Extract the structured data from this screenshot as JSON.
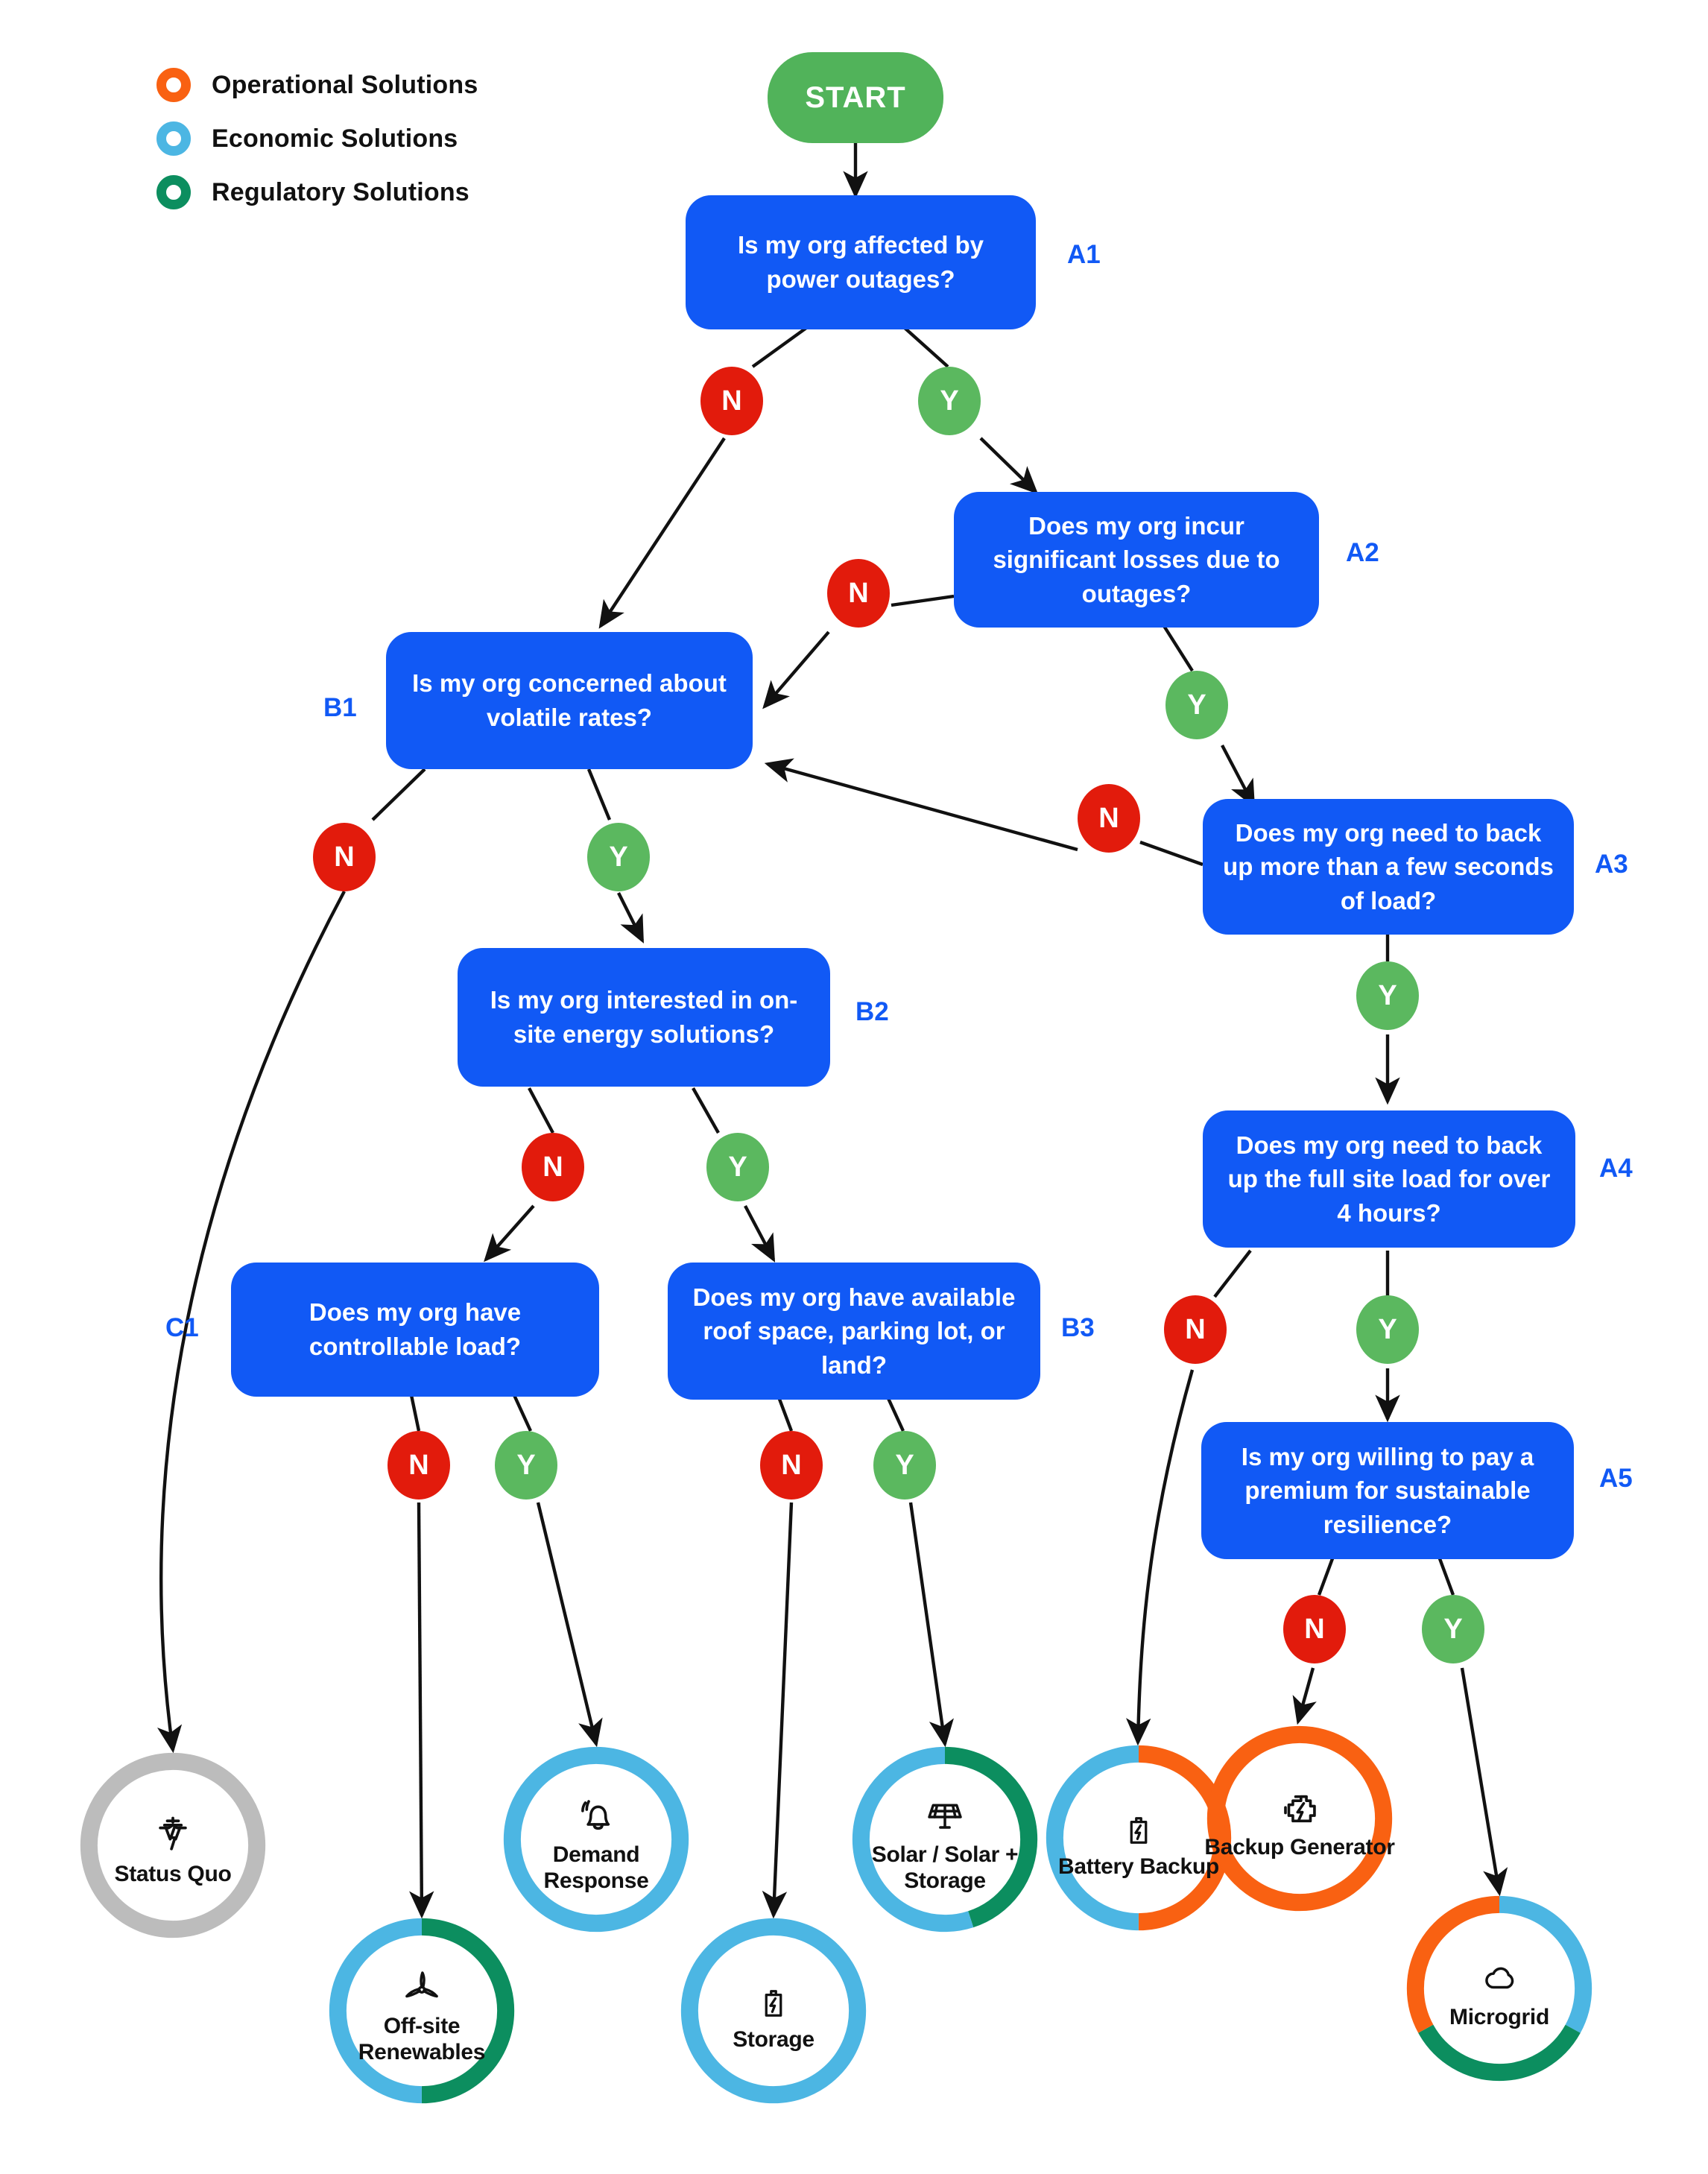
{
  "legend": {
    "items": [
      {
        "label": "Operational Solutions",
        "color": "#f96112",
        "icon": "ring-icon"
      },
      {
        "label": "Economic Solutions",
        "color": "#4cb6e3",
        "icon": "ring-icon"
      },
      {
        "label": "Regulatory Solutions",
        "color": "#0c8e5f",
        "icon": "ring-icon"
      }
    ]
  },
  "palette": {
    "question_blue": "#1159f5",
    "start_green": "#51b35a",
    "no_red": "#e21b0c",
    "yes_green": "#5bb85f",
    "operational_orange": "#f96112",
    "economic_blue": "#4cb6e3",
    "regulatory_green": "#0c8e5f",
    "status_quo_gray": "#bcbcbc"
  },
  "start": {
    "label": "START"
  },
  "questions": [
    {
      "id": "A1",
      "tag": "A1",
      "text": "Is my org affected by power outages?"
    },
    {
      "id": "A2",
      "tag": "A2",
      "text": "Does my org incur significant losses due to outages?"
    },
    {
      "id": "B1",
      "tag": "B1",
      "text": "Is my org concerned about volatile rates?"
    },
    {
      "id": "A3",
      "tag": "A3",
      "text": "Does my org need to back up more than a few seconds of load?"
    },
    {
      "id": "B2",
      "tag": "B2",
      "text": "Is my org interested in on-site energy solutions?"
    },
    {
      "id": "A4",
      "tag": "A4",
      "text": "Does my org need to back up the full site load for over 4 hours?"
    },
    {
      "id": "C1",
      "tag": "C1",
      "text": "Does my org have controllable load?"
    },
    {
      "id": "B3",
      "tag": "B3",
      "text": "Does my org have available roof space, parking lot, or land?"
    },
    {
      "id": "A5",
      "tag": "A5",
      "text": "Is my org willing to pay a premium for sustainable resilience?"
    }
  ],
  "branches": [
    {
      "id": "a1-n",
      "label": "N",
      "type": "no"
    },
    {
      "id": "a1-y",
      "label": "Y",
      "type": "yes"
    },
    {
      "id": "a2-n",
      "label": "N",
      "type": "no"
    },
    {
      "id": "a2-y",
      "label": "Y",
      "type": "yes"
    },
    {
      "id": "a3-n",
      "label": "N",
      "type": "no"
    },
    {
      "id": "a3-y",
      "label": "Y",
      "type": "yes"
    },
    {
      "id": "b1-n",
      "label": "N",
      "type": "no"
    },
    {
      "id": "b1-y",
      "label": "Y",
      "type": "yes"
    },
    {
      "id": "b2-n",
      "label": "N",
      "type": "no"
    },
    {
      "id": "b2-y",
      "label": "Y",
      "type": "yes"
    },
    {
      "id": "a4-n",
      "label": "N",
      "type": "no"
    },
    {
      "id": "a4-y",
      "label": "Y",
      "type": "yes"
    },
    {
      "id": "c1-n",
      "label": "N",
      "type": "no"
    },
    {
      "id": "c1-y",
      "label": "Y",
      "type": "yes"
    },
    {
      "id": "b3-n",
      "label": "N",
      "type": "no"
    },
    {
      "id": "b3-y",
      "label": "Y",
      "type": "yes"
    },
    {
      "id": "a5-n",
      "label": "N",
      "type": "no"
    },
    {
      "id": "a5-y",
      "label": "Y",
      "type": "yes"
    }
  ],
  "outcomes": [
    {
      "id": "status-quo",
      "label": "Status Quo",
      "icon": "transmission-tower-icon",
      "segments": [
        {
          "color": "#bcbcbc",
          "pct": 100
        }
      ]
    },
    {
      "id": "demand-response",
      "label": "Demand Response",
      "icon": "bell-icon",
      "segments": [
        {
          "color": "#4cb6e3",
          "pct": 100
        }
      ]
    },
    {
      "id": "off-site-renewables",
      "label": "Off-site Renewables",
      "icon": "wind-turbine-icon",
      "segments": [
        {
          "color": "#4cb6e3",
          "pct": 50
        },
        {
          "color": "#0c8e5f",
          "pct": 50
        }
      ]
    },
    {
      "id": "solar-storage",
      "label": "Solar / Solar + Storage",
      "icon": "solar-panel-icon",
      "segments": [
        {
          "color": "#4cb6e3",
          "pct": 55
        },
        {
          "color": "#0c8e5f",
          "pct": 45
        }
      ]
    },
    {
      "id": "storage",
      "label": "Storage",
      "icon": "battery-bolt-icon",
      "segments": [
        {
          "color": "#4cb6e3",
          "pct": 100
        }
      ]
    },
    {
      "id": "battery-backup",
      "label": "Battery Backup",
      "icon": "battery-bolt-icon",
      "segments": [
        {
          "color": "#f96112",
          "pct": 50
        },
        {
          "color": "#4cb6e3",
          "pct": 50
        }
      ]
    },
    {
      "id": "backup-generator",
      "label": "Backup Generator",
      "icon": "engine-icon",
      "segments": [
        {
          "color": "#f96112",
          "pct": 100
        }
      ]
    },
    {
      "id": "microgrid",
      "label": "Microgrid",
      "icon": "cloud-icon",
      "segments": [
        {
          "color": "#4cb6e3",
          "pct": 33
        },
        {
          "color": "#0c8e5f",
          "pct": 34
        },
        {
          "color": "#f96112",
          "pct": 33
        }
      ]
    }
  ]
}
